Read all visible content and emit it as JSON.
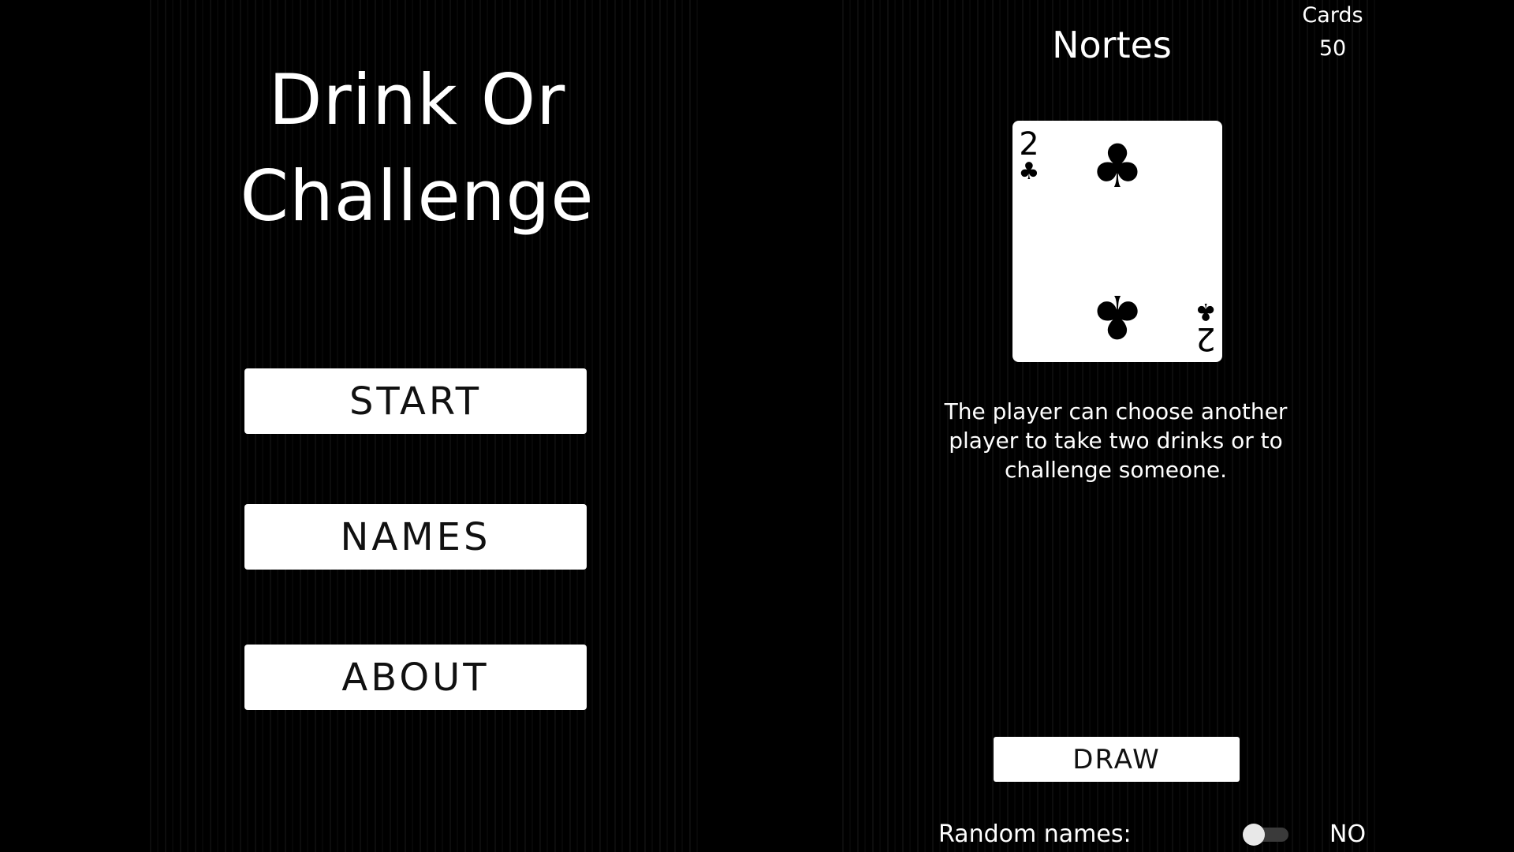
{
  "menu": {
    "title_line1": "Drink Or",
    "title_line2": "Challenge",
    "start_label": "START",
    "names_label": "NAMES",
    "about_label": "ABOUT"
  },
  "game": {
    "player_name": "Nortes",
    "cards_label": "Cards",
    "cards_remaining": "50",
    "card": {
      "rank": "2",
      "suit": "♣",
      "suit_name": "clubs",
      "pip_count": 2
    },
    "rule_text": "The player can choose another player to take two drinks or to challenge someone.",
    "draw_label": "DRAW",
    "random_names_label": "Random names:",
    "random_names_on": false,
    "random_names_value": "NO"
  },
  "colors": {
    "background": "#000000",
    "foreground": "#ffffff",
    "button_text": "#111111",
    "toggle_track": "#3a3a3a",
    "toggle_knob": "#e8e8e8"
  }
}
